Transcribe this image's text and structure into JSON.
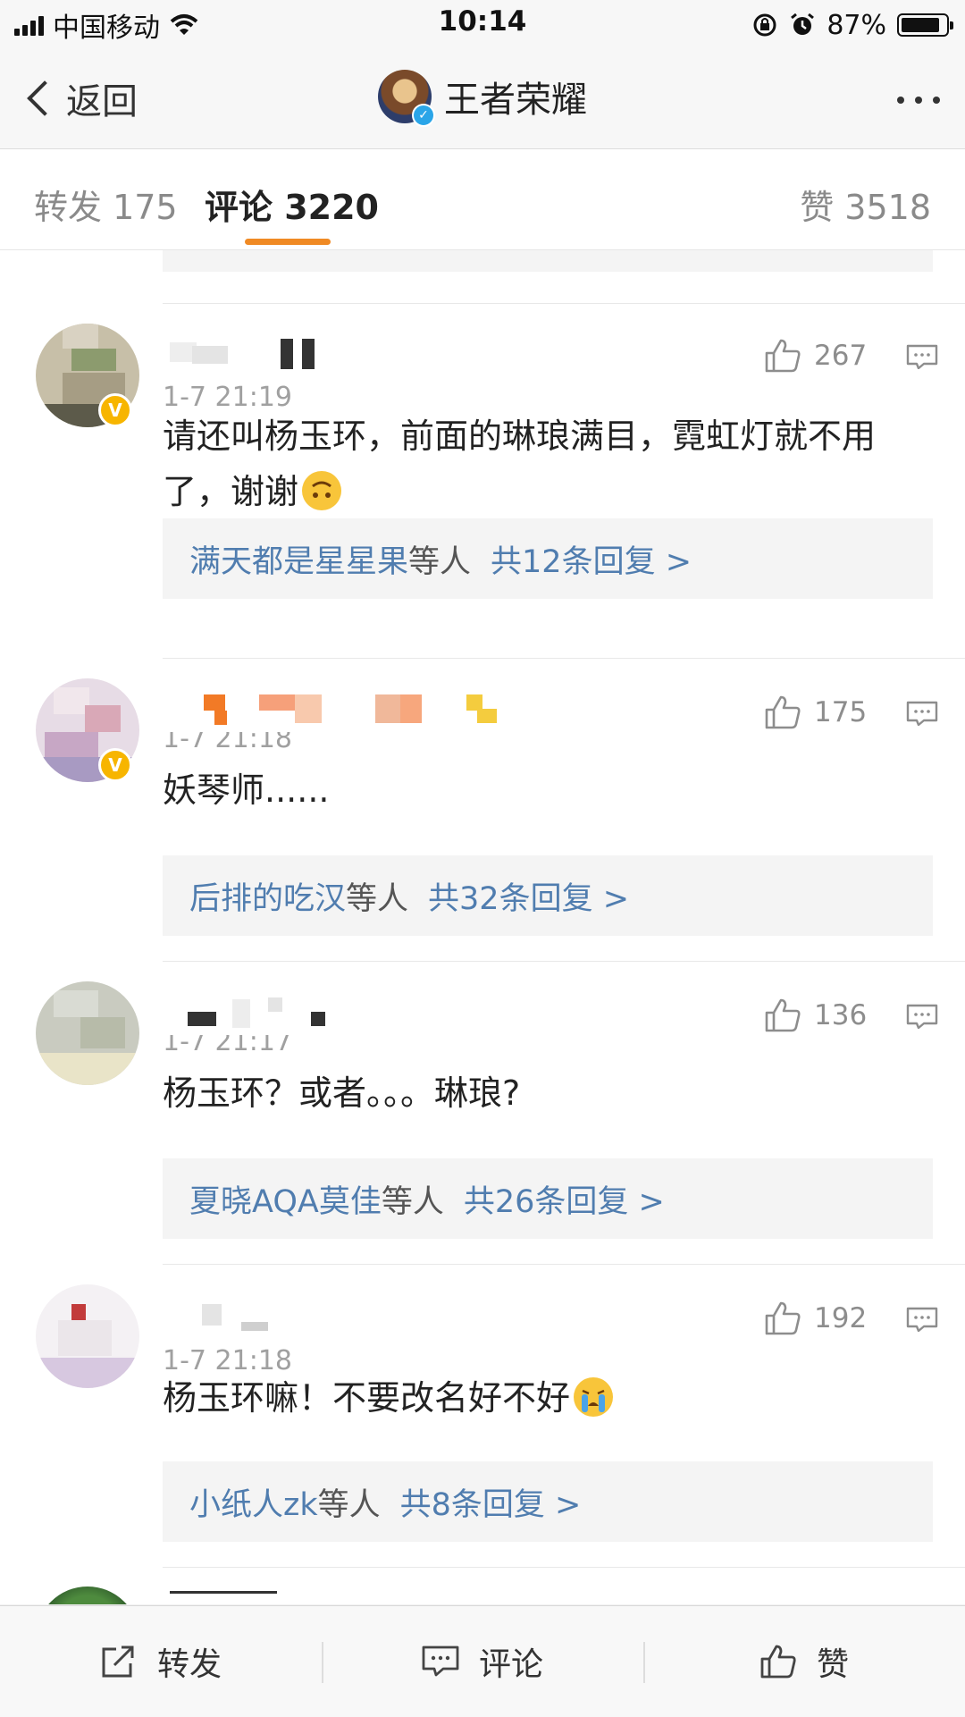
{
  "status_bar": {
    "carrier": "中国移动",
    "time": "10:14",
    "battery": "87%",
    "battery_level": 0.87
  },
  "nav": {
    "back_label": "返回",
    "title": "王者荣耀"
  },
  "tabs": {
    "repost": "转发 175",
    "comments": "评论 3220",
    "likes": "赞 3518"
  },
  "comments": [
    {
      "time": "1-7 21:19",
      "likes": "267",
      "text": "请还叫杨玉环，前面的琳琅满目，霓虹灯就不用了，谢谢",
      "reply_names": "满天都是星星果",
      "reply_etc": "等人",
      "reply_count": "共12条回复 >"
    },
    {
      "time": "1-7 21:18",
      "likes": "175",
      "text": "妖琴师......",
      "reply_names": "后排的吃汉",
      "reply_etc": "等人",
      "reply_count": "共32条回复 >"
    },
    {
      "time": "1-7 21:17",
      "likes": "136",
      "text": "杨玉环？或者。。。琳琅?",
      "reply_names": "夏晓AQA莫佳",
      "reply_etc": "等人",
      "reply_count": "共26条回复 >"
    },
    {
      "time": "1-7 21:18",
      "likes": "192",
      "text": "杨玉环嘛！不要改名好不好",
      "reply_names": "小纸人zk",
      "reply_etc": "等人",
      "reply_count": "共8条回复 >"
    }
  ],
  "bottom_bar": {
    "repost": "转发",
    "comment": "评论",
    "like": "赞"
  }
}
